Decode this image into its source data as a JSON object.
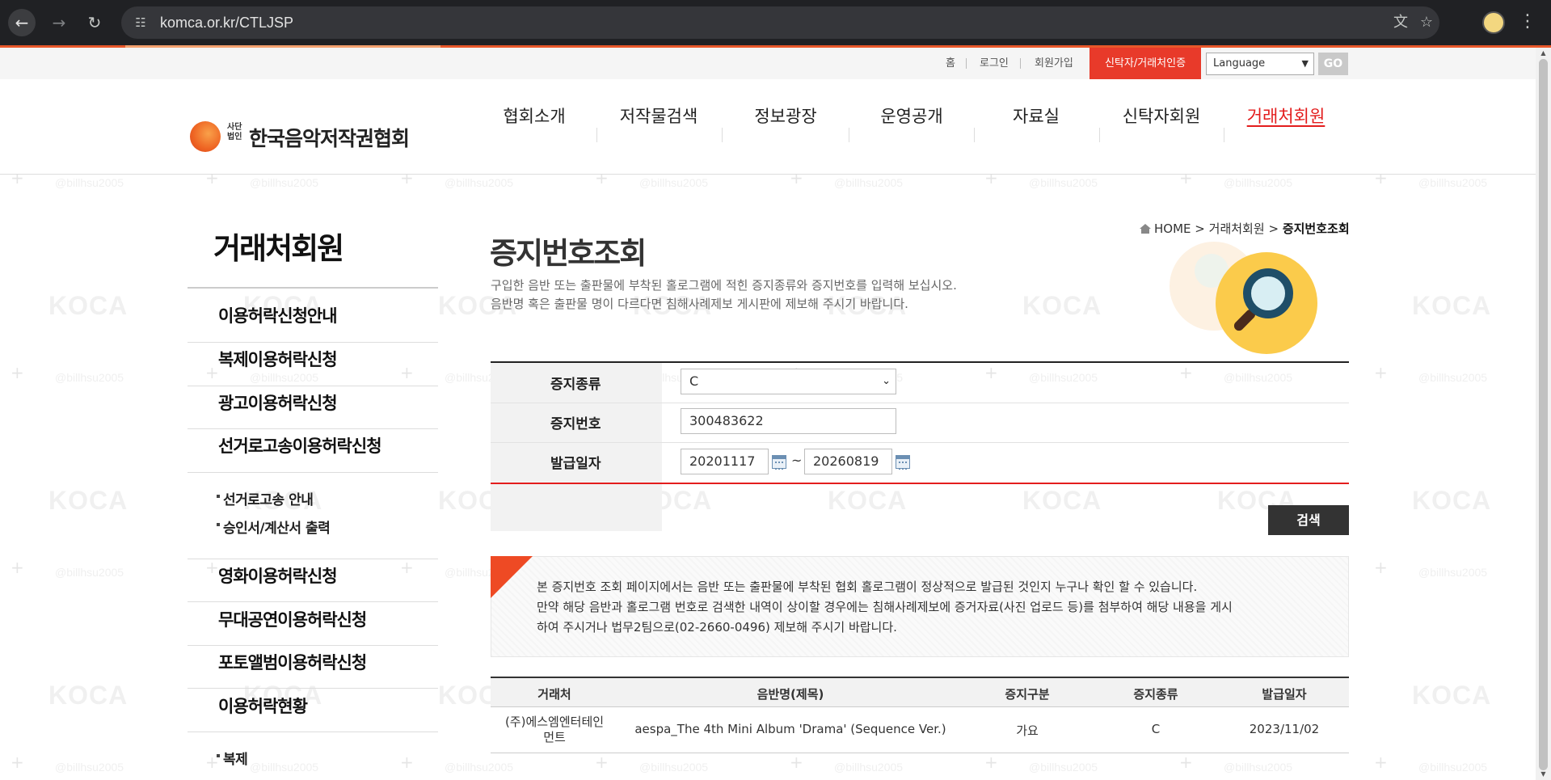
{
  "browser": {
    "url": "komca.or.kr/CTLJSP",
    "icons": [
      "back-arrow-icon",
      "forward-arrow-icon",
      "reload-icon",
      "site-info-icon",
      "translate-icon",
      "star-icon",
      "profile-avatar",
      "kebab-menu-icon"
    ]
  },
  "util": {
    "home": "홈",
    "login": "로그인",
    "join": "회원가입",
    "cert": "신탁자/거래처인증",
    "language": "Language",
    "go": "GO"
  },
  "logo": {
    "small": "사단법인",
    "name": "한국음악저작권협회"
  },
  "gnb": [
    {
      "label": "협회소개"
    },
    {
      "label": "저작물검색"
    },
    {
      "label": "정보광장"
    },
    {
      "label": "운영공개"
    },
    {
      "label": "자료실"
    },
    {
      "label": "신탁자회원"
    },
    {
      "label": "거래처회원"
    }
  ],
  "sidebar": {
    "title": "거래처회원",
    "items": [
      {
        "label": "이용허락신청안내"
      },
      {
        "label": "복제이용허락신청"
      },
      {
        "label": "광고이용허락신청"
      },
      {
        "label": "선거로고송이용허락신청"
      },
      {
        "label": "영화이용허락신청"
      },
      {
        "label": "무대공연이용허락신청"
      },
      {
        "label": "포토앨범이용허락신청"
      },
      {
        "label": "이용허락현황"
      }
    ],
    "sub_election": [
      {
        "label": "선거로고송 안내"
      },
      {
        "label": "승인서/계산서 출력"
      }
    ],
    "sub_status": [
      {
        "label": "복제"
      }
    ]
  },
  "breadcrumb": {
    "home": "HOME",
    "sep1": ">",
    "level1": "거래처회원",
    "sep2": ">",
    "current": "증지번호조회"
  },
  "main": {
    "title": "증지번호조회",
    "desc1": "구입한 음반 또는 출판물에 부착된 홀로그램에 적힌 증지종류와 증지번호를 입력해 보십시오.",
    "desc2": "음반명 혹은 출판물 명이 다르다면 침해사례제보 게시판에 제보해 주시기 바랍니다."
  },
  "form": {
    "type_label": "증지종류",
    "type_value": "C",
    "number_label": "증지번호",
    "number_value": "300483622",
    "date_label": "발급일자",
    "date_from": "20201117",
    "date_tilde": "~",
    "date_to": "20260819",
    "search": "검색"
  },
  "notice": {
    "line1": "본 증지번호 조회 페이지에서는 음반 또는 출판물에 부착된 협회 홀로그램이 정상적으로 발급된 것인지 누구나 확인 할 수 있습니다.",
    "line2": "만약 해당 음반과 홀로그램 번호로 검색한 내역이 상이할 경우에는 침해사례제보에 증거자료(사진 업로드 등)를 첨부하여 해당 내용을 게시",
    "line3": "하여 주시거나 법무2팀으로(02-2660-0496) 제보해 주시기 바랍니다."
  },
  "table": {
    "headers": [
      "거래처",
      "음반명(제목)",
      "증지구분",
      "증지종류",
      "발급일자"
    ],
    "rows": [
      {
        "client_line1": "(주)에스엠엔터테인",
        "client_line2": "먼트",
        "album": "aespa_The 4th Mini Album 'Drama' (Sequence Ver.)",
        "category": "가요",
        "type": "C",
        "date": "2023/11/02"
      }
    ]
  },
  "watermark": {
    "logo": "KOCA",
    "handle": "@billhsu2005"
  },
  "colors": {
    "accent_red": "#e31d1d",
    "cert_bg": "#e83a2a",
    "dark_button": "#333333"
  }
}
